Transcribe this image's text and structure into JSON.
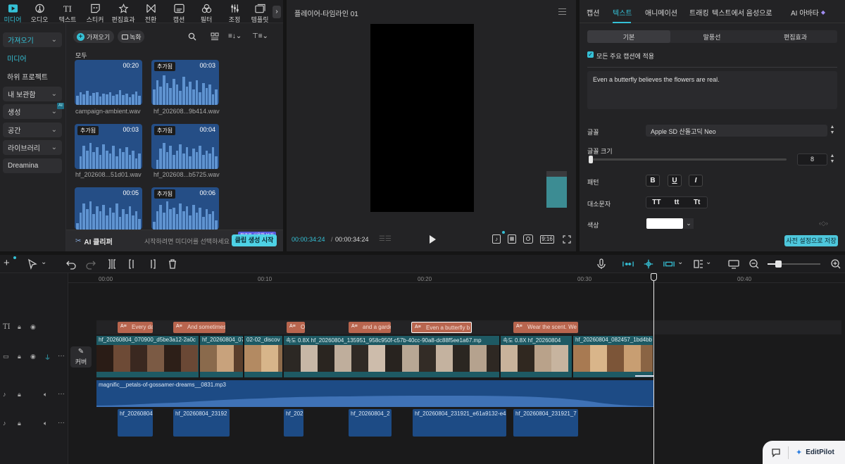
{
  "toolbar": {
    "items": [
      {
        "label": "미디어",
        "icon": "media-icon",
        "active": true
      },
      {
        "label": "오디오",
        "icon": "audio-icon"
      },
      {
        "label": "텍스트",
        "icon": "text-icon"
      },
      {
        "label": "스티커",
        "icon": "sticker-icon"
      },
      {
        "label": "편집효과",
        "icon": "effects-icon"
      },
      {
        "label": "전환",
        "icon": "transition-icon"
      },
      {
        "label": "캡션",
        "icon": "caption-icon"
      },
      {
        "label": "필터",
        "icon": "filter-icon"
      },
      {
        "label": "조정",
        "icon": "adjust-icon"
      },
      {
        "label": "템플릿",
        "icon": "template-icon"
      }
    ]
  },
  "sidebar": {
    "import_label": "가져오기",
    "media_label": "미디어",
    "sub_project_label": "하위 프로젝트",
    "my_collection_label": "내 보관함",
    "generate_label": "생성",
    "ai_badge": "AI",
    "space_label": "공간",
    "library_label": "라이브러리",
    "dreamina_label": "Dreamina"
  },
  "media": {
    "import_button": "가져오기",
    "record_button": "녹화",
    "section_label": "모두",
    "added_tag": "추가됨",
    "items": [
      {
        "name": "campaign-ambient.wav",
        "duration": "00:20",
        "added": false
      },
      {
        "name": "hf_202608...9b414.wav",
        "duration": "00:03",
        "added": true
      },
      {
        "name": "hf_202608...51d01.wav",
        "duration": "00:03",
        "added": true
      },
      {
        "name": "hf_202608...b5725.wav",
        "duration": "00:04",
        "added": true
      },
      {
        "name": "",
        "duration": "00:05",
        "added": false
      },
      {
        "name": "",
        "duration": "00:06",
        "added": true
      }
    ],
    "ai_clipper_label": "AI 클리퍼",
    "hint_text": "시작하려면 미디어를 선택하세요",
    "generate_button": "클립 생성 시작",
    "free_badge": "무료로 사용해 보기"
  },
  "player": {
    "title": "플레이어-타임라인 01",
    "current_time": "00:00:34:24",
    "total_time": "00:00:34:24",
    "ratio": "9:16"
  },
  "inspector": {
    "tabs": [
      "캡션",
      "텍스트",
      "애니메이션",
      "트래킹",
      "텍스트에서 음성으로",
      "AI 아바타"
    ],
    "active_tab": 1,
    "subtabs": [
      "기본",
      "말풍선",
      "편집효과"
    ],
    "apply_all_label": "모든 주요 캡션에 적용",
    "text_value": "Even a butterfly believes the flowers are real.",
    "font_label": "글꼴",
    "font_value": "Apple SD 산돌고딕 Neo",
    "font_size_label": "글꼴 크기",
    "font_size_value": "8",
    "font_size_fraction": 0.0,
    "pattern_label": "패턴",
    "pattern_buttons": [
      "B",
      "U",
      "I"
    ],
    "case_label": "대소문자",
    "case_buttons": [
      "TT",
      "tt",
      "Tt"
    ],
    "color_label": "색상",
    "color_value": "#ffffff",
    "save_preset_button": "사전 설정으로 저장"
  },
  "timeline": {
    "ruler": [
      "00:00",
      "00:10",
      "00:20",
      "00:30",
      "00:40"
    ],
    "cover_label": "커버",
    "zoom_fraction": 0.2,
    "captions": [
      "Every da",
      "And sometimes",
      "Or",
      "and a garde",
      "Even a butterfly b",
      "Wear the scent. We"
    ],
    "video_clips": [
      {
        "label": "hf_20260804_070900_d5be3a12-2a0c"
      },
      {
        "label": "hf_20260804_07"
      },
      {
        "label": "02-02_discov"
      },
      {
        "label": "속도 0.8X  hf_20260804_135951_958c950f-c57b-40cc-90a8-dc88f5ee1a67.mp"
      },
      {
        "label": "속도 0.8X  hf_20260804"
      },
      {
        "label": "hf_20260804_082457_1bd4bb"
      }
    ],
    "music_clip": "magnific__petals-of-gossamer-dreams__0831.mp3",
    "audio_clips": [
      "hf_20260804",
      "hf_20260804_23192",
      "hf_202",
      "hf_20260804_2",
      "hf_20260804_231921_e61a9132-e4",
      "hf_20260804_231921_7"
    ]
  },
  "footer": {
    "brand": "EditPilot"
  }
}
